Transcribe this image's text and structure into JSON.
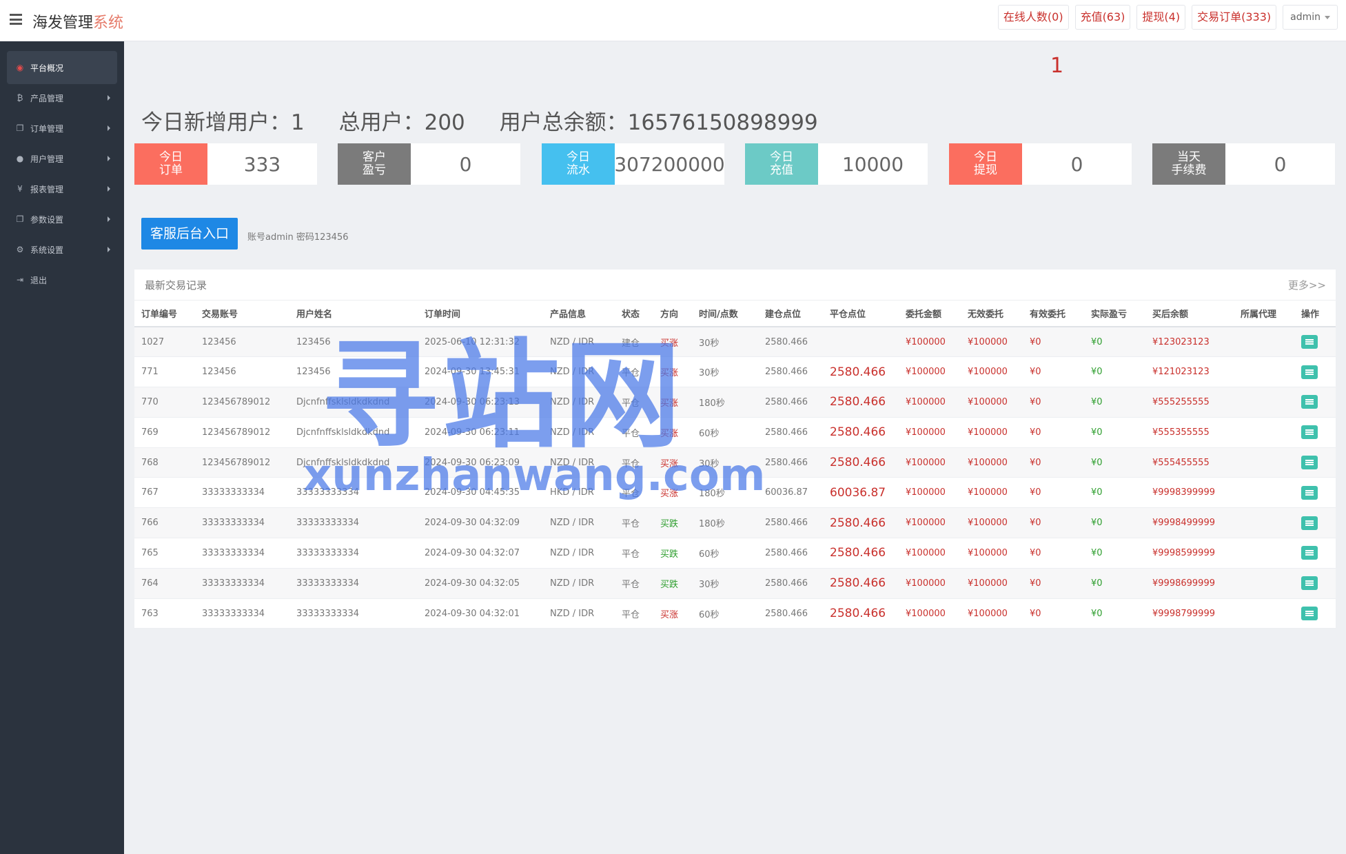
{
  "app": {
    "title_main": "海发管理",
    "title_accent": "系统"
  },
  "header": {
    "buttons": [
      {
        "label": "在线人数(0)"
      },
      {
        "label": "充值(63)"
      },
      {
        "label": "提现(4)"
      },
      {
        "label": "交易订单(333)"
      }
    ],
    "user": "admin"
  },
  "sidebar": {
    "items": [
      {
        "label": "平台概况",
        "icon": "dashboard-icon",
        "glyph": "◉"
      },
      {
        "label": "产品管理",
        "icon": "bitcoin-icon",
        "glyph": "₿"
      },
      {
        "label": "订单管理",
        "icon": "copy-icon",
        "glyph": "❐"
      },
      {
        "label": "用户管理",
        "icon": "user-icon",
        "glyph": "●"
      },
      {
        "label": "报表管理",
        "icon": "yen-icon",
        "glyph": "¥"
      },
      {
        "label": "参数设置",
        "icon": "copy-icon",
        "glyph": "❐"
      },
      {
        "label": "系统设置",
        "icon": "gears-icon",
        "glyph": "⚙"
      },
      {
        "label": "退出",
        "icon": "sign-out-icon",
        "glyph": "⇥"
      }
    ]
  },
  "alert_number": "1",
  "summary": {
    "new_users": "今日新增用户：1",
    "total_users": "总用户：200",
    "total_balance": "用户总余额：16576150898999"
  },
  "stats": [
    {
      "label": "今日\n订单",
      "value": "333",
      "color": "#fb6e5f"
    },
    {
      "label": "客户\n盈亏",
      "value": "0",
      "color": "#7b7b7b"
    },
    {
      "label": "今日\n流水",
      "value": "307200000",
      "color": "#45c0ef"
    },
    {
      "label": "今日\n充值",
      "value": "10000",
      "color": "#6ccac6"
    },
    {
      "label": "今日\n提现",
      "value": "0",
      "color": "#fb6e5f"
    },
    {
      "label": "当天\n手续费",
      "value": "0",
      "color": "#7b7b7b"
    }
  ],
  "cs": {
    "button": "客服后台入口",
    "note": "账号admin 密码123456"
  },
  "records": {
    "title": "最新交易记录",
    "more": "更多>>",
    "columns": [
      "订单编号",
      "交易账号",
      "用户姓名",
      "订单时间",
      "产品信息",
      "状态",
      "方向",
      "时间/点数",
      "建仓点位",
      "平仓点位",
      "委托金额",
      "无效委托",
      "有效委托",
      "实际盈亏",
      "买后余额",
      "所属代理",
      "操作"
    ],
    "rows": [
      [
        "1027",
        "123456",
        "123456",
        "2025-06-10 12:31:32",
        "NZD / IDR",
        "建仓",
        "买涨",
        "30秒",
        "2580.466",
        "",
        "¥100000",
        "¥100000",
        "¥0",
        "¥0",
        "¥123023123",
        ""
      ],
      [
        "771",
        "123456",
        "123456",
        "2024-09-30 13:45:31",
        "NZD / IDR",
        "平仓",
        "买涨",
        "30秒",
        "2580.466",
        "2580.466",
        "¥100000",
        "¥100000",
        "¥0",
        "¥0",
        "¥121023123",
        ""
      ],
      [
        "770",
        "123456789012",
        "Djcnfnffsklsldkdkdnd",
        "2024-09-30 06:23:13",
        "NZD / IDR",
        "平仓",
        "买涨",
        "180秒",
        "2580.466",
        "2580.466",
        "¥100000",
        "¥100000",
        "¥0",
        "¥0",
        "¥555255555",
        ""
      ],
      [
        "769",
        "123456789012",
        "Djcnfnffsklsldkdkdnd",
        "2024-09-30 06:23:11",
        "NZD / IDR",
        "平仓",
        "买涨",
        "60秒",
        "2580.466",
        "2580.466",
        "¥100000",
        "¥100000",
        "¥0",
        "¥0",
        "¥555355555",
        ""
      ],
      [
        "768",
        "123456789012",
        "Djcnfnffsklsldkdkdnd",
        "2024-09-30 06:23:09",
        "NZD / IDR",
        "平仓",
        "买涨",
        "30秒",
        "2580.466",
        "2580.466",
        "¥100000",
        "¥100000",
        "¥0",
        "¥0",
        "¥555455555",
        ""
      ],
      [
        "767",
        "33333333334",
        "33333333334",
        "2024-09-30 04:45:35",
        "HKD / IDR",
        "平仓",
        "买涨",
        "180秒",
        "60036.87",
        "60036.87",
        "¥100000",
        "¥100000",
        "¥0",
        "¥0",
        "¥9998399999",
        ""
      ],
      [
        "766",
        "33333333334",
        "33333333334",
        "2024-09-30 04:32:09",
        "NZD / IDR",
        "平仓",
        "买跌",
        "180秒",
        "2580.466",
        "2580.466",
        "¥100000",
        "¥100000",
        "¥0",
        "¥0",
        "¥9998499999",
        ""
      ],
      [
        "765",
        "33333333334",
        "33333333334",
        "2024-09-30 04:32:07",
        "NZD / IDR",
        "平仓",
        "买跌",
        "60秒",
        "2580.466",
        "2580.466",
        "¥100000",
        "¥100000",
        "¥0",
        "¥0",
        "¥9998599999",
        ""
      ],
      [
        "764",
        "33333333334",
        "33333333334",
        "2024-09-30 04:32:05",
        "NZD / IDR",
        "平仓",
        "买跌",
        "30秒",
        "2580.466",
        "2580.466",
        "¥100000",
        "¥100000",
        "¥0",
        "¥0",
        "¥9998699999",
        ""
      ],
      [
        "763",
        "33333333334",
        "33333333334",
        "2024-09-30 04:32:01",
        "NZD / IDR",
        "平仓",
        "买涨",
        "60秒",
        "2580.466",
        "2580.466",
        "¥100000",
        "¥100000",
        "¥0",
        "¥0",
        "¥9998799999",
        ""
      ]
    ]
  },
  "watermark": {
    "cn": "寻站网",
    "en": "xunzhanwang.com"
  }
}
